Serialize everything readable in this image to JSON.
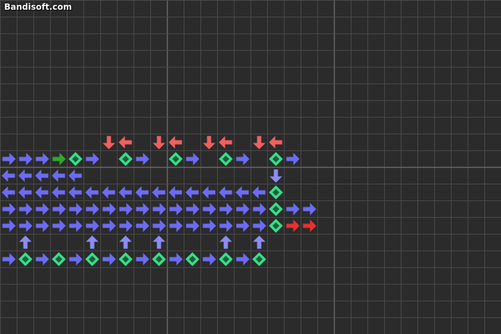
{
  "watermark": "Bandisoft.com",
  "colors": {
    "background": "#2b2b2b",
    "grid": "#4a4a4a",
    "grid_major": "#6a6a6a",
    "arrow_blue": "#6b6cf2",
    "arrow_blue_light": "#8c8cf5",
    "arrow_red": "#f06060",
    "arrow_red_bright": "#e83030",
    "arrow_green": "#2ea82e",
    "diamond_fill": "#36e08a",
    "diamond_inner": "#1f5c3c"
  },
  "board": {
    "cell_types": [
      "arrow-right",
      "arrow-left",
      "arrow-up",
      "arrow-down",
      "diamond"
    ],
    "cells": [
      [
        "arrow-down",
        6,
        8,
        "red"
      ],
      [
        "arrow-left",
        7,
        8,
        "red"
      ],
      [
        "arrow-down",
        9,
        8,
        "red"
      ],
      [
        "arrow-left",
        10,
        8,
        "red"
      ],
      [
        "arrow-down",
        12,
        8,
        "red"
      ],
      [
        "arrow-left",
        13,
        8,
        "red"
      ],
      [
        "arrow-down",
        15,
        8,
        "red"
      ],
      [
        "arrow-left",
        16,
        8,
        "red"
      ],
      [
        "arrow-right",
        0,
        9,
        "blue"
      ],
      [
        "arrow-right",
        1,
        9,
        "blue"
      ],
      [
        "arrow-right",
        2,
        9,
        "blue"
      ],
      [
        "arrow-right",
        3,
        9,
        "green"
      ],
      [
        "diamond",
        4,
        9,
        "green"
      ],
      [
        "arrow-right",
        5,
        9,
        "blue"
      ],
      [
        "diamond",
        7,
        9,
        "green"
      ],
      [
        "arrow-right",
        8,
        9,
        "blue"
      ],
      [
        "diamond",
        10,
        9,
        "green"
      ],
      [
        "arrow-right",
        11,
        9,
        "blue"
      ],
      [
        "diamond",
        13,
        9,
        "green"
      ],
      [
        "arrow-right",
        14,
        9,
        "blue"
      ],
      [
        "diamond",
        16,
        9,
        "green"
      ],
      [
        "arrow-right",
        17,
        9,
        "blue"
      ],
      [
        "arrow-left",
        0,
        10,
        "blue"
      ],
      [
        "arrow-left",
        1,
        10,
        "blue"
      ],
      [
        "arrow-left",
        2,
        10,
        "blue"
      ],
      [
        "arrow-left",
        3,
        10,
        "blue"
      ],
      [
        "arrow-left",
        4,
        10,
        "blue"
      ],
      [
        "arrow-down",
        16,
        10,
        "blue_light"
      ],
      [
        "arrow-left",
        0,
        11,
        "blue"
      ],
      [
        "arrow-left",
        1,
        11,
        "blue"
      ],
      [
        "arrow-left",
        2,
        11,
        "blue"
      ],
      [
        "arrow-left",
        3,
        11,
        "blue"
      ],
      [
        "arrow-left",
        4,
        11,
        "blue"
      ],
      [
        "arrow-left",
        5,
        11,
        "blue"
      ],
      [
        "arrow-left",
        6,
        11,
        "blue"
      ],
      [
        "arrow-left",
        7,
        11,
        "blue"
      ],
      [
        "arrow-left",
        8,
        11,
        "blue"
      ],
      [
        "arrow-left",
        9,
        11,
        "blue"
      ],
      [
        "arrow-left",
        10,
        11,
        "blue"
      ],
      [
        "arrow-left",
        11,
        11,
        "blue"
      ],
      [
        "arrow-left",
        12,
        11,
        "blue"
      ],
      [
        "arrow-left",
        13,
        11,
        "blue"
      ],
      [
        "arrow-left",
        14,
        11,
        "blue"
      ],
      [
        "arrow-left",
        15,
        11,
        "blue"
      ],
      [
        "diamond",
        16,
        11,
        "green"
      ],
      [
        "arrow-right",
        0,
        12,
        "blue"
      ],
      [
        "arrow-right",
        1,
        12,
        "blue"
      ],
      [
        "arrow-right",
        2,
        12,
        "blue"
      ],
      [
        "arrow-right",
        3,
        12,
        "blue"
      ],
      [
        "arrow-right",
        4,
        12,
        "blue"
      ],
      [
        "arrow-right",
        5,
        12,
        "blue"
      ],
      [
        "arrow-right",
        6,
        12,
        "blue"
      ],
      [
        "arrow-right",
        7,
        12,
        "blue"
      ],
      [
        "arrow-right",
        8,
        12,
        "blue"
      ],
      [
        "arrow-right",
        9,
        12,
        "blue"
      ],
      [
        "arrow-right",
        10,
        12,
        "blue"
      ],
      [
        "arrow-right",
        11,
        12,
        "blue"
      ],
      [
        "arrow-right",
        12,
        12,
        "blue"
      ],
      [
        "arrow-right",
        13,
        12,
        "blue"
      ],
      [
        "arrow-right",
        14,
        12,
        "blue"
      ],
      [
        "arrow-right",
        15,
        12,
        "blue"
      ],
      [
        "diamond",
        16,
        12,
        "green"
      ],
      [
        "arrow-right",
        17,
        12,
        "blue"
      ],
      [
        "arrow-right",
        18,
        12,
        "blue"
      ],
      [
        "arrow-right",
        0,
        13,
        "blue"
      ],
      [
        "arrow-right",
        1,
        13,
        "blue"
      ],
      [
        "arrow-right",
        2,
        13,
        "blue"
      ],
      [
        "arrow-right",
        3,
        13,
        "blue"
      ],
      [
        "arrow-right",
        4,
        13,
        "blue"
      ],
      [
        "arrow-right",
        5,
        13,
        "blue"
      ],
      [
        "arrow-right",
        6,
        13,
        "blue"
      ],
      [
        "arrow-right",
        7,
        13,
        "blue"
      ],
      [
        "arrow-right",
        8,
        13,
        "blue"
      ],
      [
        "arrow-right",
        9,
        13,
        "blue"
      ],
      [
        "arrow-right",
        10,
        13,
        "blue"
      ],
      [
        "arrow-right",
        11,
        13,
        "blue"
      ],
      [
        "arrow-right",
        12,
        13,
        "blue"
      ],
      [
        "arrow-right",
        13,
        13,
        "blue"
      ],
      [
        "arrow-right",
        14,
        13,
        "blue"
      ],
      [
        "arrow-right",
        15,
        13,
        "blue"
      ],
      [
        "diamond",
        16,
        13,
        "green"
      ],
      [
        "arrow-right",
        17,
        13,
        "red_bright"
      ],
      [
        "arrow-right",
        18,
        13,
        "red_bright"
      ],
      [
        "arrow-up",
        1,
        14,
        "blue_light"
      ],
      [
        "arrow-up",
        5,
        14,
        "blue_light"
      ],
      [
        "arrow-up",
        7,
        14,
        "blue_light"
      ],
      [
        "arrow-up",
        9,
        14,
        "blue_light"
      ],
      [
        "arrow-up",
        13,
        14,
        "blue_light"
      ],
      [
        "arrow-up",
        15,
        14,
        "blue_light"
      ],
      [
        "arrow-right",
        0,
        15,
        "blue"
      ],
      [
        "diamond",
        1,
        15,
        "green"
      ],
      [
        "arrow-right",
        2,
        15,
        "blue"
      ],
      [
        "diamond",
        3,
        15,
        "green"
      ],
      [
        "arrow-right",
        4,
        15,
        "blue"
      ],
      [
        "diamond",
        5,
        15,
        "green"
      ],
      [
        "arrow-right",
        6,
        15,
        "blue"
      ],
      [
        "diamond",
        7,
        15,
        "green"
      ],
      [
        "arrow-right",
        8,
        15,
        "blue"
      ],
      [
        "diamond",
        9,
        15,
        "green"
      ],
      [
        "arrow-right",
        10,
        15,
        "blue"
      ],
      [
        "diamond",
        11,
        15,
        "green"
      ],
      [
        "arrow-right",
        12,
        15,
        "blue"
      ],
      [
        "diamond",
        13,
        15,
        "green"
      ],
      [
        "arrow-right",
        14,
        15,
        "blue"
      ],
      [
        "diamond",
        15,
        15,
        "green"
      ]
    ]
  }
}
